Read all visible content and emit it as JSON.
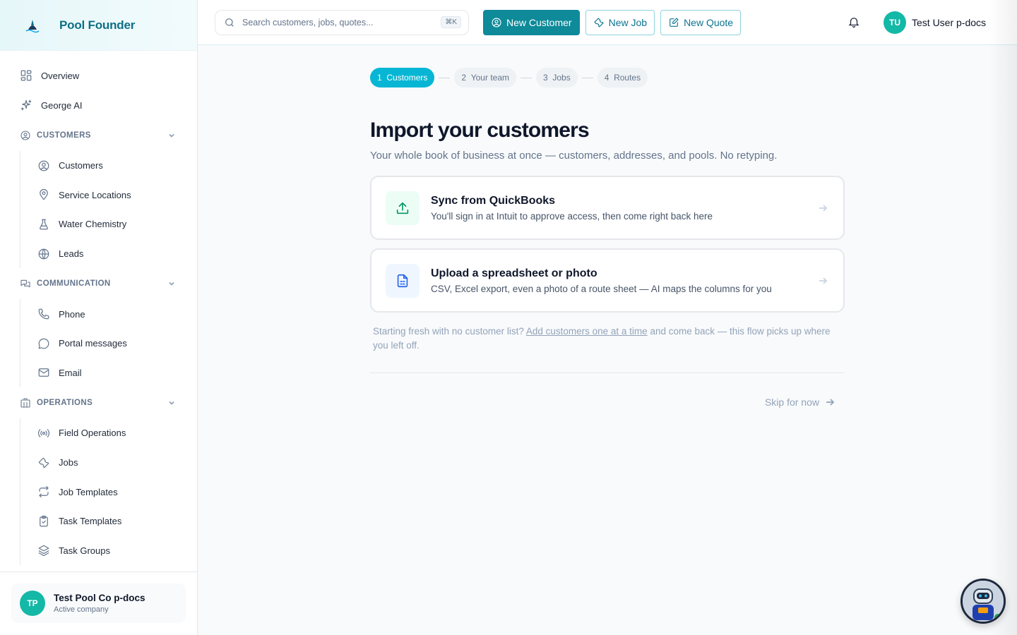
{
  "brand": {
    "name": "Pool Founder"
  },
  "nav": {
    "top": [
      {
        "label": "Overview",
        "icon": "grid-icon"
      },
      {
        "label": "George AI",
        "icon": "sparkles-icon"
      }
    ],
    "sections": [
      {
        "label": "CUSTOMERS",
        "items": [
          "Customers",
          "Service Locations",
          "Water Chemistry",
          "Leads"
        ]
      },
      {
        "label": "COMMUNICATION",
        "items": [
          "Phone",
          "Portal messages",
          "Email"
        ]
      },
      {
        "label": "OPERATIONS",
        "items": [
          "Field Operations",
          "Jobs",
          "Job Templates",
          "Task Templates",
          "Task Groups"
        ]
      }
    ]
  },
  "company": {
    "initials": "TP",
    "name": "Test Pool Co p-docs",
    "status": "Active company"
  },
  "header": {
    "search_placeholder": "Search customers, jobs, quotes...",
    "search_shortcut": "⌘K",
    "new_customer": "New Customer",
    "new_job": "New Job",
    "new_quote": "New Quote",
    "user_initials": "TU",
    "user_name": "Test User p-docs"
  },
  "steps": [
    {
      "num": "1",
      "label": "Customers",
      "active": true
    },
    {
      "num": "2",
      "label": "Your team",
      "active": false
    },
    {
      "num": "3",
      "label": "Jobs",
      "active": false
    },
    {
      "num": "4",
      "label": "Routes",
      "active": false
    }
  ],
  "page": {
    "title": "Import your customers",
    "subtitle": "Your whole book of business at once — customers, addresses, and pools. No retyping."
  },
  "options": [
    {
      "title": "Sync from QuickBooks",
      "desc": "You'll sign in at Intuit to approve access, then come right back here",
      "icon": "upload-icon"
    },
    {
      "title": "Upload a spreadsheet or photo",
      "desc": "CSV, Excel export, even a photo of a route sheet — AI maps the columns for you",
      "icon": "spreadsheet-icon"
    }
  ],
  "note": {
    "before": "Starting fresh with no customer list? ",
    "link": "Add customers one at a time",
    "after": " and come back — this flow picks up where you left off."
  },
  "skip_label": "Skip for now",
  "colors": {
    "accent": "#06b6d4",
    "primary_button": "#0e8a99",
    "avatar": "#14b8a6",
    "brand_text": "#0e6f86"
  }
}
